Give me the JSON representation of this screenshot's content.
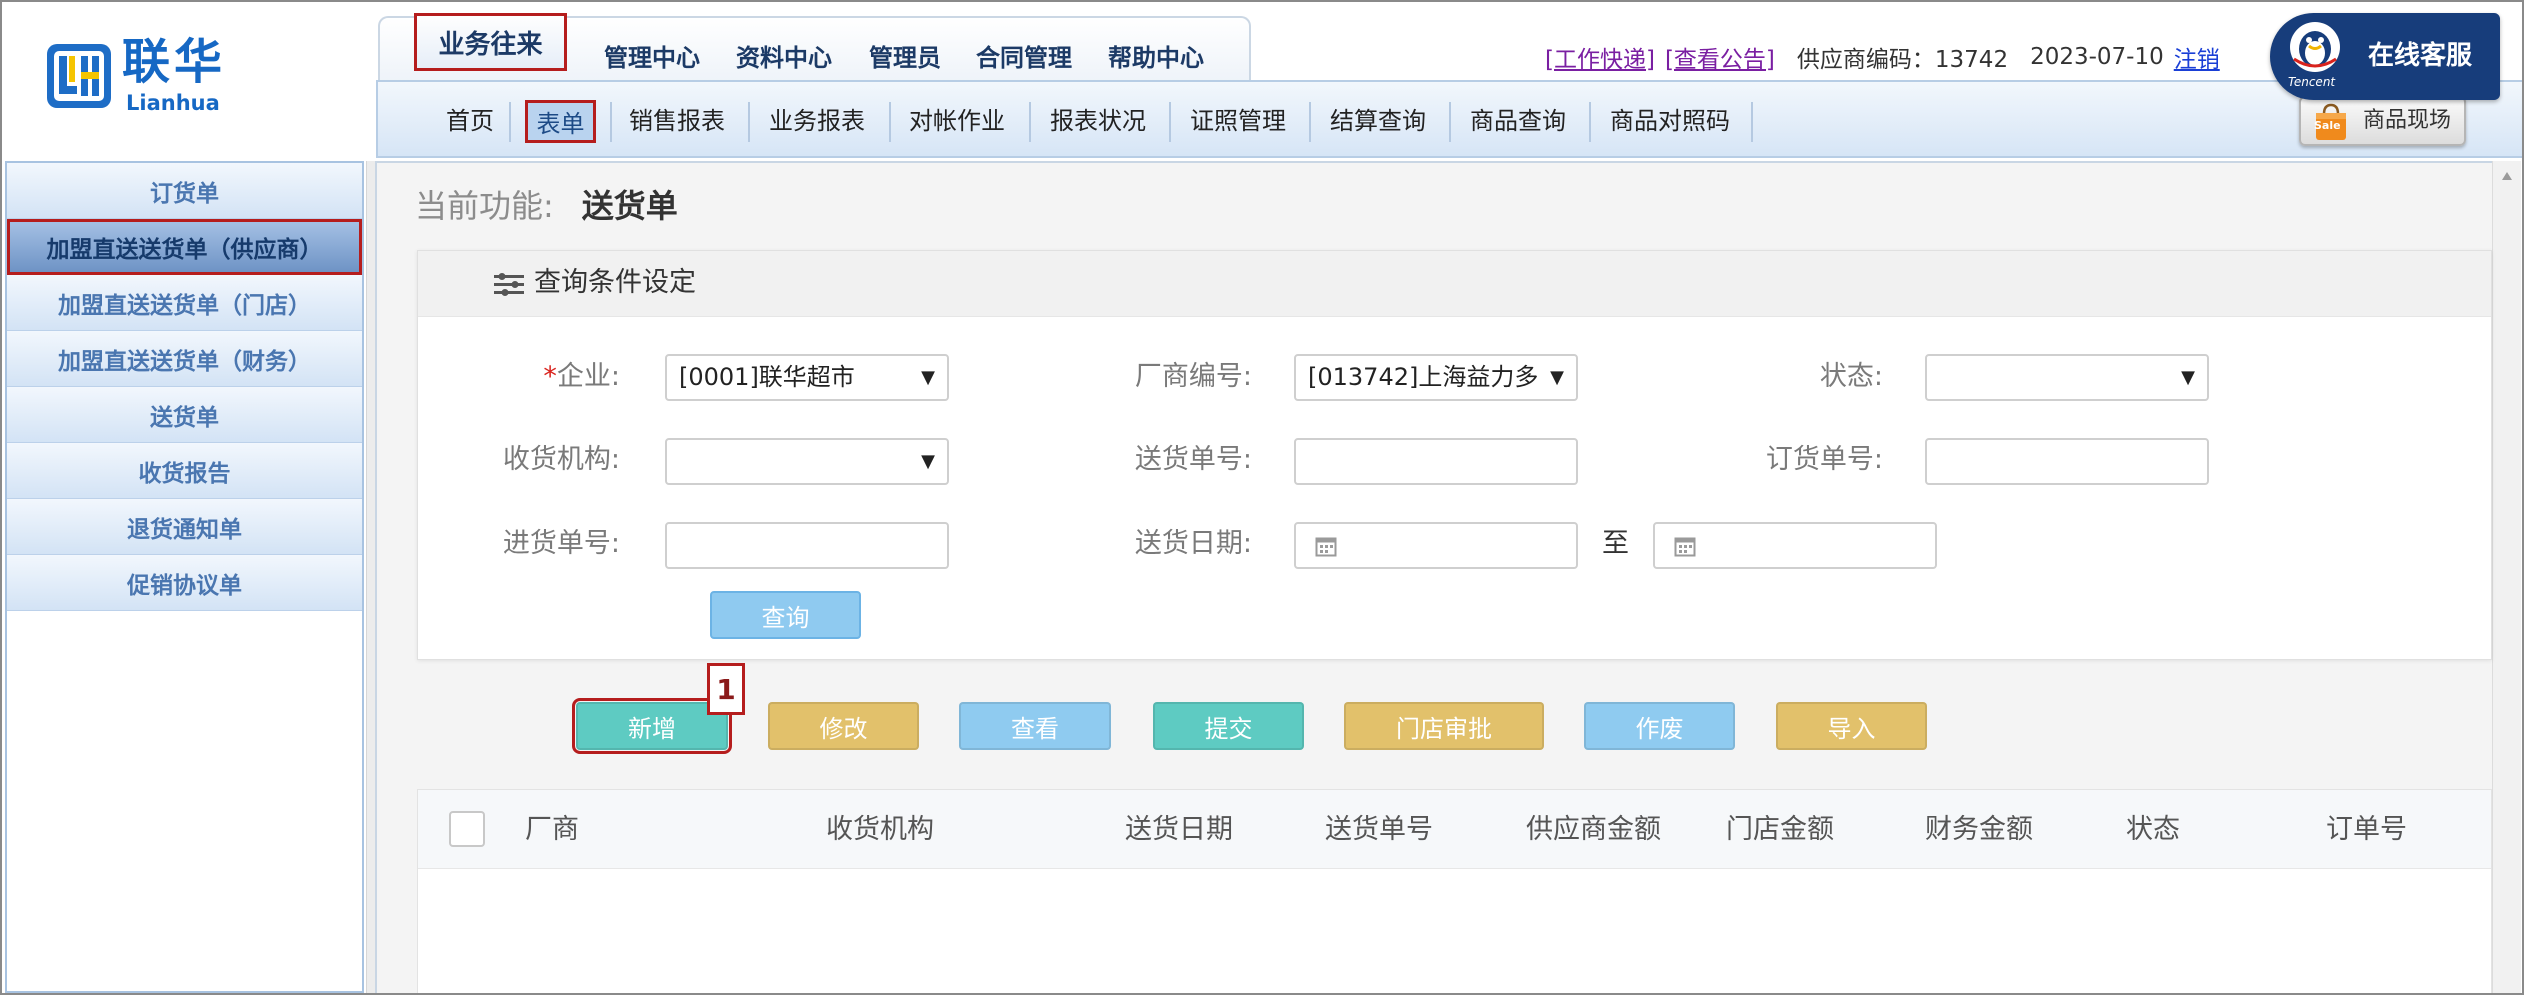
{
  "logo": {
    "name_cn": "联华",
    "name_en": "Lianhua",
    "icon": "lianhua-logo-icon"
  },
  "top_tabs": [
    {
      "label": "业务往来",
      "active": true
    },
    {
      "label": "管理中心",
      "active": false
    },
    {
      "label": "资料中心",
      "active": false
    },
    {
      "label": "管理员",
      "active": false
    },
    {
      "label": "合同管理",
      "active": false
    },
    {
      "label": "帮助中心",
      "active": false
    }
  ],
  "header_links": {
    "work_express": "[工作快递]",
    "notice": "[查看公告]",
    "supplier_code": "供应商编码：13742",
    "date": "2023-07-10",
    "logout": "注销"
  },
  "online_service": {
    "label": "在线客服",
    "brand": "Tencent",
    "icon": "tencent-penguin-icon"
  },
  "nav": [
    {
      "label": "首页",
      "active": false
    },
    {
      "label": "表单",
      "active": true
    },
    {
      "label": "销售报表",
      "active": false
    },
    {
      "label": "业务报表",
      "active": false
    },
    {
      "label": "对帐作业",
      "active": false
    },
    {
      "label": "报表状况",
      "active": false
    },
    {
      "label": "证照管理",
      "active": false
    },
    {
      "label": "结算查询",
      "active": false
    },
    {
      "label": "商品查询",
      "active": false
    },
    {
      "label": "商品对照码",
      "active": false
    }
  ],
  "promo_button": {
    "label": "商品现场",
    "icon_text": "Sale",
    "icon": "sale-bag-icon"
  },
  "sidebar": {
    "items": [
      {
        "label": "订货单",
        "active": false
      },
      {
        "label": "加盟直送送货单（供应商）",
        "active": true
      },
      {
        "label": "加盟直送送货单（门店）",
        "active": false
      },
      {
        "label": "加盟直送送货单（财务）",
        "active": false
      },
      {
        "label": "送货单",
        "active": false
      },
      {
        "label": "收货报告",
        "active": false
      },
      {
        "label": "退货通知单",
        "active": false
      },
      {
        "label": "促销协议单",
        "active": false
      }
    ]
  },
  "page": {
    "function_label": "当前功能:",
    "function_name": "送货单"
  },
  "query": {
    "title": "查询条件设定",
    "icon": "filter-list-icon",
    "required_mark": "*",
    "fields": {
      "company": {
        "label": "企业:",
        "value": "[0001]联华超市"
      },
      "vendor_code": {
        "label": "厂商编号:",
        "value": "[013742]上海益力多"
      },
      "status": {
        "label": "状态:",
        "value": ""
      },
      "receiving_org": {
        "label": "收货机构:",
        "value": ""
      },
      "delivery_no": {
        "label": "送货单号:",
        "value": ""
      },
      "order_no": {
        "label": "订货单号:",
        "value": ""
      },
      "purchase_no": {
        "label": "进货单号:",
        "value": ""
      },
      "delivery_date": {
        "label": "送货日期:",
        "from": "",
        "to": "",
        "separator": "至",
        "icon": "calendar-icon"
      }
    },
    "submit_label": "查询"
  },
  "actions": [
    {
      "label": "新增",
      "color": "#5ecbc2",
      "highlighted": true
    },
    {
      "label": "修改",
      "color": "#e2c16b",
      "highlighted": false
    },
    {
      "label": "查看",
      "color": "#8fcbf0",
      "highlighted": false
    },
    {
      "label": "提交",
      "color": "#5ecbc2",
      "highlighted": false
    },
    {
      "label": "门店审批",
      "color": "#e2c16b",
      "highlighted": false
    },
    {
      "label": "作废",
      "color": "#8fcbf0",
      "highlighted": false
    },
    {
      "label": "导入",
      "color": "#e2c16b",
      "highlighted": false
    }
  ],
  "step_badge": "1",
  "table": {
    "select_all_checked": false,
    "columns": [
      "厂商",
      "收货机构",
      "送货日期",
      "送货单号",
      "供应商金额",
      "门店金额",
      "财务金额",
      "状态",
      "订单号"
    ],
    "rows": []
  },
  "colors": {
    "brand_blue": "#1668c4",
    "highlight_red": "#b51d1d",
    "nav_text": "#1c3a66",
    "sidebar_text": "#4a76b0",
    "online_service_bg": "#173d7b"
  }
}
